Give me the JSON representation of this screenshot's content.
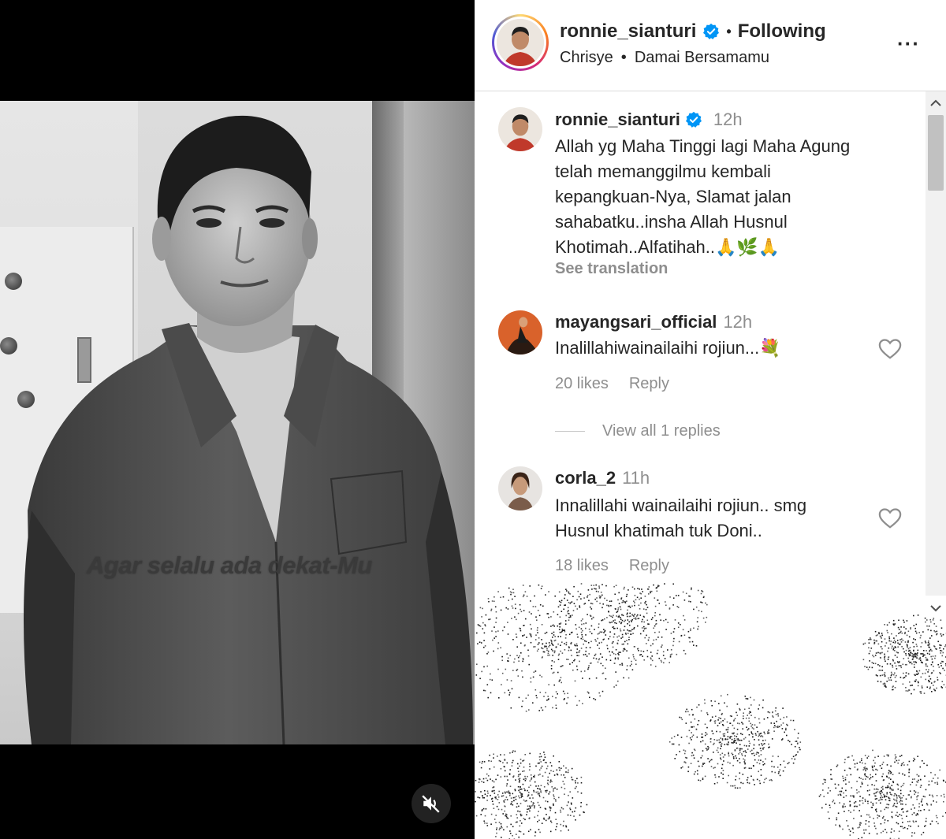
{
  "media": {
    "overlay_text": "Agar selalu ada dekat-Mu",
    "mute_icon": "speaker-muted-icon"
  },
  "header": {
    "username": "ronnie_sianturi",
    "separator": "•",
    "follow_status": "Following",
    "audio_artist": "Chrisye",
    "audio_separator": "•",
    "audio_title": "Damai Bersamamu",
    "more_icon": "more-horizontal-icon",
    "more_label": "···"
  },
  "caption": {
    "username": "ronnie_sianturi",
    "time": "12h",
    "lines": [
      "Allah yg Maha Tinggi lagi Maha Agung",
      "telah memanggilmu kembali",
      "kepangkuan-Nya, Slamat jalan",
      "sahabatku..insha Allah Husnul",
      "Khotimah..Alfatihah..🙏🌿🙏"
    ],
    "see_translation": "See translation"
  },
  "comments": [
    {
      "username": "mayangsari_official",
      "time": "12h",
      "lines": [
        "Inalillahiwainailaihi rojiun...💐"
      ],
      "likes": "20 likes",
      "reply": "Reply",
      "view_replies": "View all 1 replies"
    },
    {
      "username": "corla_2",
      "time": "11h",
      "lines": [
        "Innalillahi wainailaihi rojiun.. smg",
        "Husnul khatimah tuk Doni.."
      ],
      "likes": "18 likes",
      "reply": "Reply"
    }
  ],
  "colors": {
    "verified": "#0095f6",
    "secondary_text": "#8e8e8e",
    "primary_text": "#262626"
  }
}
